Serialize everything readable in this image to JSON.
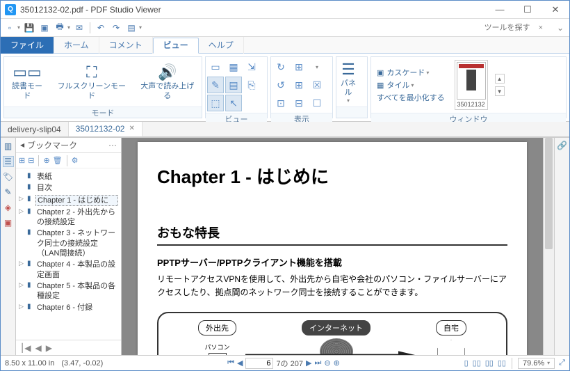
{
  "titlebar": {
    "app_icon_letter": "Q",
    "title": "35012132-02.pdf - PDF Studio Viewer"
  },
  "quick": {
    "search_placeholder": "ツールを探す"
  },
  "menutabs": {
    "file": "ファイル",
    "home": "ホーム",
    "comment": "コメント",
    "view": "ビュー",
    "help": "ヘルプ"
  },
  "ribbon": {
    "mode": {
      "label": "モード",
      "read": "読書モード",
      "fullscreen": "フルスクリーンモード",
      "readaloud": "大声で読み上げる"
    },
    "view": {
      "label": "ビュー"
    },
    "display": {
      "label": "表示"
    },
    "panel": {
      "label": "パネ\nル"
    },
    "window": {
      "label": "ウィンドウ",
      "cascade": "カスケード",
      "tile": "タイル",
      "minimize": "すべてを最小化する",
      "thumb_caption": "35012132"
    }
  },
  "doctabs": {
    "tab1": "delivery-slip04",
    "tab2": "35012132-02"
  },
  "bookmarks": {
    "title": "ブックマーク",
    "items": [
      {
        "label": "表紙",
        "arrow": ""
      },
      {
        "label": "目次",
        "arrow": ""
      },
      {
        "label": "Chapter 1 - はじめに",
        "arrow": "▷",
        "sel": true
      },
      {
        "label": "Chapter 2 - 外出先からの接続設定",
        "arrow": "▷"
      },
      {
        "label": "Chapter 3 - ネットワーク同士の接続設定（LAN間接続）",
        "arrow": ""
      },
      {
        "label": "Chapter 4 - 本製品の設定画面",
        "arrow": "▷"
      },
      {
        "label": "Chapter 5 - 本製品の各種設定",
        "arrow": "▷"
      },
      {
        "label": "Chapter 6 - 付録",
        "arrow": "▷"
      }
    ]
  },
  "page": {
    "h1": "Chapter 1 - はじめに",
    "h2": "おもな特長",
    "h3": "PPTPサーバー/PPTPクライアント機能を搭載",
    "p": "リモートアクセスVPNを使用して、外出先から自宅や会社のパソコン・ファイルサーバーにアクセスしたり、拠点間のネットワーク同士を接続することができます。",
    "pill1": "外出先",
    "pill2": "インターネット",
    "pill3": "自宅",
    "cap1": "パソコン"
  },
  "status": {
    "dims": "8.50 x 11.00 in",
    "coords": "(3.47, -0.02)",
    "page": "6",
    "of": "7の 207",
    "zoom": "79.6%"
  }
}
